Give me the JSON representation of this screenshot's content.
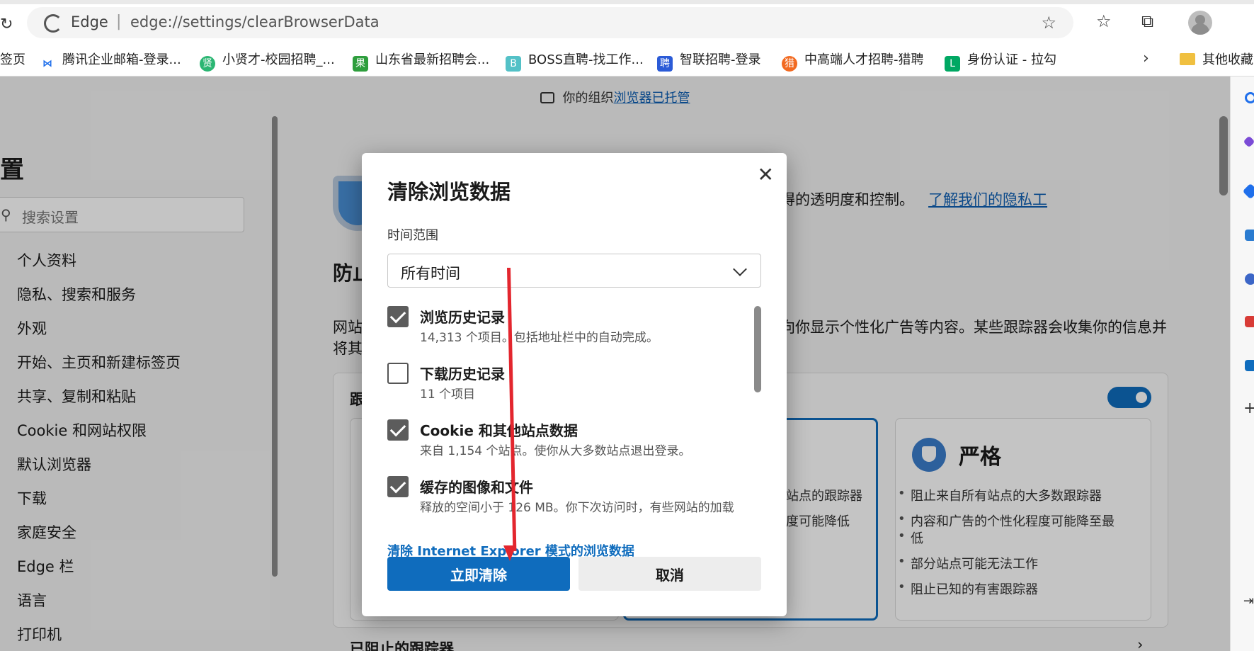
{
  "browser": {
    "brand": "Edge",
    "url": "edge://settings/clearBrowserData"
  },
  "bookmarks": [
    {
      "label": "签页",
      "icon": "tab-icon",
      "color": "#555555"
    },
    {
      "label": "腾讯企业邮箱-登录...",
      "icon": "tencent-mail-icon",
      "color": "#1f6feb"
    },
    {
      "label": "小贤才-校园招聘_...",
      "icon": "xiaoxiancai-icon",
      "color": "#2bb673"
    },
    {
      "label": "山东省最新招聘会...",
      "icon": "shandong-icon",
      "color": "#2e9e3d"
    },
    {
      "label": "BOSS直聘-找工作...",
      "icon": "boss-icon",
      "color": "#53c1c7"
    },
    {
      "label": "智联招聘-登录",
      "icon": "zhilian-icon",
      "color": "#2b5bd7"
    },
    {
      "label": "中高端人才招聘-猎聘",
      "icon": "liepin-icon",
      "color": "#f26a21"
    },
    {
      "label": "身份认证 - 拉勾",
      "icon": "lagou-icon",
      "color": "#00a863"
    },
    {
      "label": "其他收藏",
      "icon": "folder-icon",
      "color": "#f0c040"
    }
  ],
  "managed_banner": {
    "prefix": "你的组织",
    "link": "浏览器已托管"
  },
  "sidebar": {
    "title": "置",
    "search_placeholder": "搜索设置",
    "items": [
      {
        "label": "个人资料"
      },
      {
        "label": "隐私、搜索和服务"
      },
      {
        "label": "外观"
      },
      {
        "label": "开始、主页和新建标签页"
      },
      {
        "label": "共享、复制和粘贴"
      },
      {
        "label": "Cookie 和网站权限"
      },
      {
        "label": "默认浏览器"
      },
      {
        "label": "下载"
      },
      {
        "label": "家庭安全"
      },
      {
        "label": "Edge 栏"
      },
      {
        "label": "语言"
      },
      {
        "label": "打印机"
      }
    ]
  },
  "content": {
    "privacy_text": "得的透明度和控制。",
    "privacy_link": "了解我们的隐私工",
    "section_heading": "防止",
    "para_line1_left": "网站",
    "para_line1_right": "向你显示个性化广告等内容。某些跟踪器会收集你的信息并",
    "para_line2_left": "将其",
    "card_heading": "跟",
    "balanced_line1": "站点的跟踪器",
    "balanced_line2": "度可能降低",
    "strict": {
      "title": "严格",
      "bullets": [
        "阻止来自所有站点的大多数跟踪器",
        "内容和广告的个性化程度可能降至最",
        "低",
        "部分站点可能无法工作",
        "阻止已知的有害跟踪器"
      ]
    },
    "blocked_trackers": "已阻止的跟踪器"
  },
  "dialog": {
    "title": "清除浏览数据",
    "range_label": "时间范围",
    "range_value": "所有时间",
    "options": [
      {
        "title": "浏览历史记录",
        "desc": "14,313 个项目。包括地址栏中的自动完成。",
        "checked": true
      },
      {
        "title": "下载历史记录",
        "desc": "11 个项目",
        "checked": false
      },
      {
        "title": "Cookie 和其他站点数据",
        "desc": "来自 1,154 个站点。使你从大多数站点退出登录。",
        "checked": true
      },
      {
        "title": "缓存的图像和文件",
        "desc": "释放的空间小于 126 MB。你下次访问时，有些网站的加载",
        "checked": true
      }
    ],
    "ie_link": "清除 Internet Explorer 模式的浏览数据",
    "clear_button": "立即清除",
    "cancel_button": "取消"
  },
  "colors": {
    "accent": "#0f6cbd",
    "annotation_arrow": "#e3262e"
  }
}
